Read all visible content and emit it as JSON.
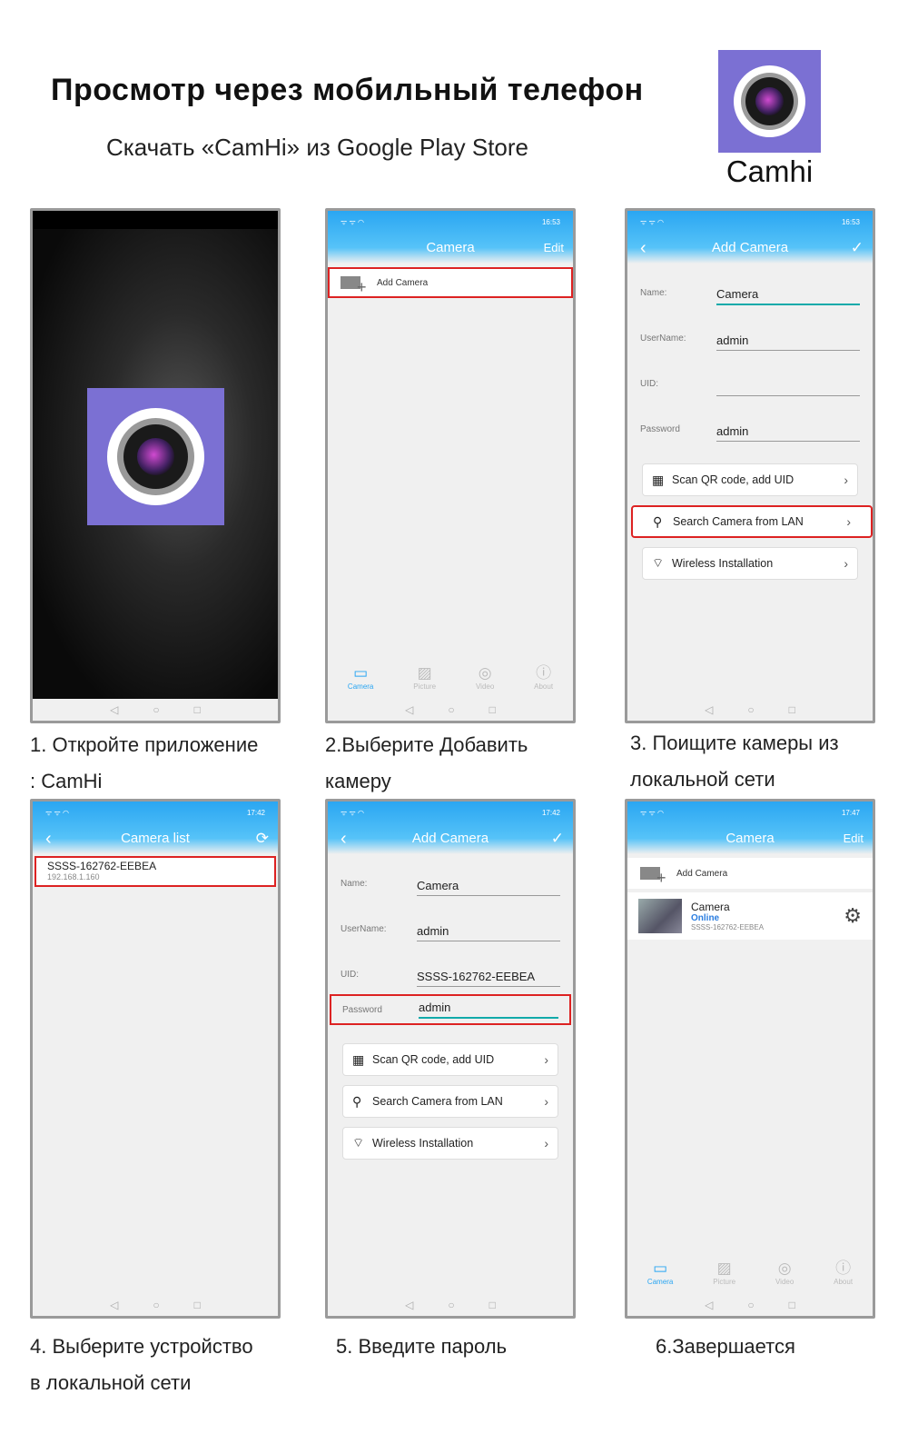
{
  "header": {
    "title": "Просмотр через мобильный телефон",
    "subtitle": "Скачать «CamHi» из Google Play Store",
    "app_name": "Camhi"
  },
  "colors": {
    "accent": "#2aa6f2",
    "icon_bg": "#7b70d3",
    "highlight": "#d22222"
  },
  "steps": [
    {
      "caption_1": "1. Откройте приложение",
      "caption_2": ": CamHi"
    },
    {
      "caption_1": "2.Выберите Добавить",
      "caption_2": "камеру"
    },
    {
      "caption_1": "3. Поищите камеры из",
      "caption_2": "локальной сети"
    },
    {
      "caption_1": "4. Выберите устройство",
      "caption_2": "в локальной сети"
    },
    {
      "caption_1": "5. Введите пароль",
      "caption_2": ""
    },
    {
      "caption_1": "6.Завершается",
      "caption_2": ""
    }
  ],
  "screen2": {
    "title": "Camera",
    "edit": "Edit",
    "time": "16:53",
    "add_camera": "Add Camera",
    "tabs": [
      "Camera",
      "Picture",
      "Video",
      "About"
    ]
  },
  "screen3": {
    "title": "Add Camera",
    "time": "16:53",
    "fields": [
      {
        "label": "Name:",
        "value": "Camera"
      },
      {
        "label": "UserName:",
        "value": "admin"
      },
      {
        "label": "UID:",
        "value": ""
      },
      {
        "label": "Password",
        "value": "admin"
      }
    ],
    "buttons": [
      "Scan QR code, add UID",
      "Search Camera from LAN",
      "Wireless Installation"
    ]
  },
  "screen4": {
    "title": "Camera list",
    "time": "17:42",
    "device_uid": "SSSS-162762-EEBEA",
    "device_ip": "192.168.1.160"
  },
  "screen5": {
    "title": "Add Camera",
    "time": "17:42",
    "fields": [
      {
        "label": "Name:",
        "value": "Camera"
      },
      {
        "label": "UserName:",
        "value": "admin"
      },
      {
        "label": "UID:",
        "value": "SSSS-162762-EEBEA"
      },
      {
        "label": "Password",
        "value": "admin"
      }
    ],
    "buttons": [
      "Scan QR code, add UID",
      "Search Camera from LAN",
      "Wireless Installation"
    ]
  },
  "screen6": {
    "title": "Camera",
    "edit": "Edit",
    "time": "17:47",
    "add_camera": "Add Camera",
    "camera_name": "Camera",
    "camera_status": "Online",
    "camera_uid": "SSSS-162762-EEBEA",
    "tabs": [
      "Camera",
      "Picture",
      "Video",
      "About"
    ]
  },
  "icons": {
    "back": "chevron-left-icon",
    "check": "check-icon",
    "refresh": "refresh-icon",
    "settings": "gear-icon",
    "qr": "qr-icon",
    "search": "search-icon",
    "wifi": "wifi-icon"
  }
}
